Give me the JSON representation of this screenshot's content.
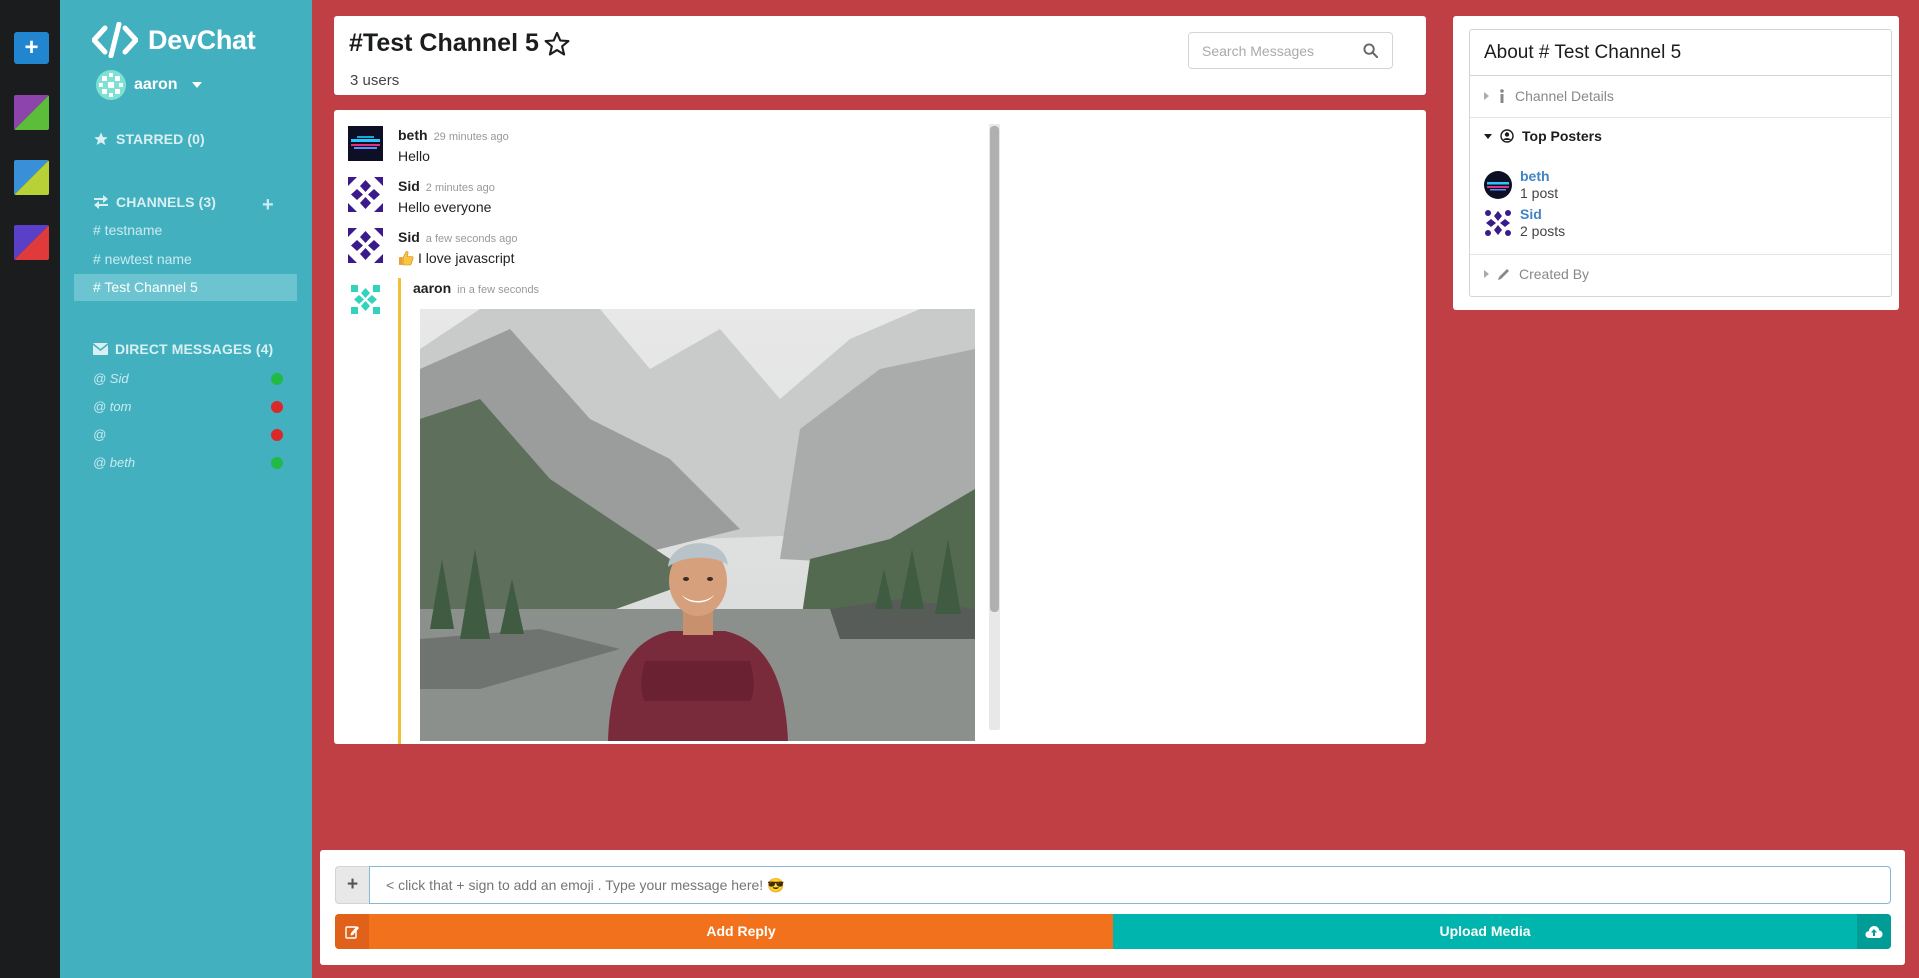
{
  "rail": {
    "add_label": "+",
    "swatches": [
      {
        "a": "#8e44ad",
        "b": "#5bbd3a"
      },
      {
        "a": "#3a8fd9",
        "b": "#b8d236"
      },
      {
        "a": "#5a3fc8",
        "b": "#e03a3a"
      }
    ]
  },
  "sidebar": {
    "brand": "DevChat",
    "user": "aaron",
    "starred_label": "STARRED (0)",
    "channels_label": "CHANNELS (3)",
    "channels": [
      "# testname",
      "# newtest name",
      "# Test Channel 5"
    ],
    "dm_label": "DIRECT MESSAGES (4)",
    "dms": [
      {
        "name": "@ Sid",
        "status": "#21ba45"
      },
      {
        "name": "@ tom",
        "status": "#db2828"
      },
      {
        "name": "@",
        "status": "#db2828"
      },
      {
        "name": "@ beth",
        "status": "#21ba45"
      }
    ]
  },
  "header": {
    "title": "#Test Channel 5",
    "users": "3 users",
    "search_placeholder": "Search Messages"
  },
  "messages": [
    {
      "author": "beth",
      "time": "29 minutes ago",
      "text": "Hello"
    },
    {
      "author": "Sid",
      "time": "2 minutes ago",
      "text": "Hello everyone"
    },
    {
      "author": "Sid",
      "time": "a few seconds ago",
      "text": "I love javascript"
    }
  ],
  "own_message": {
    "author": "aaron",
    "time": "in a few seconds"
  },
  "info": {
    "title": "About # Test Channel 5",
    "details_label": "Channel Details",
    "posters_label": "Top Posters",
    "posters": [
      {
        "name": "beth",
        "count": "1 post"
      },
      {
        "name": "Sid",
        "count": "2 posts"
      }
    ],
    "created_label": "Created By"
  },
  "composer": {
    "emoji_label": "+",
    "placeholder": "< click that + sign to add an emoji . Type your message here! 😎",
    "reply_label": "Add Reply",
    "upload_label": "Upload Media"
  },
  "colors": {
    "page_bg": "#bf3f44",
    "sidebar_bg": "#43b0c0",
    "reply_btn": "#f2711c",
    "upload_btn": "#00b5ad",
    "link": "#4183c4"
  }
}
